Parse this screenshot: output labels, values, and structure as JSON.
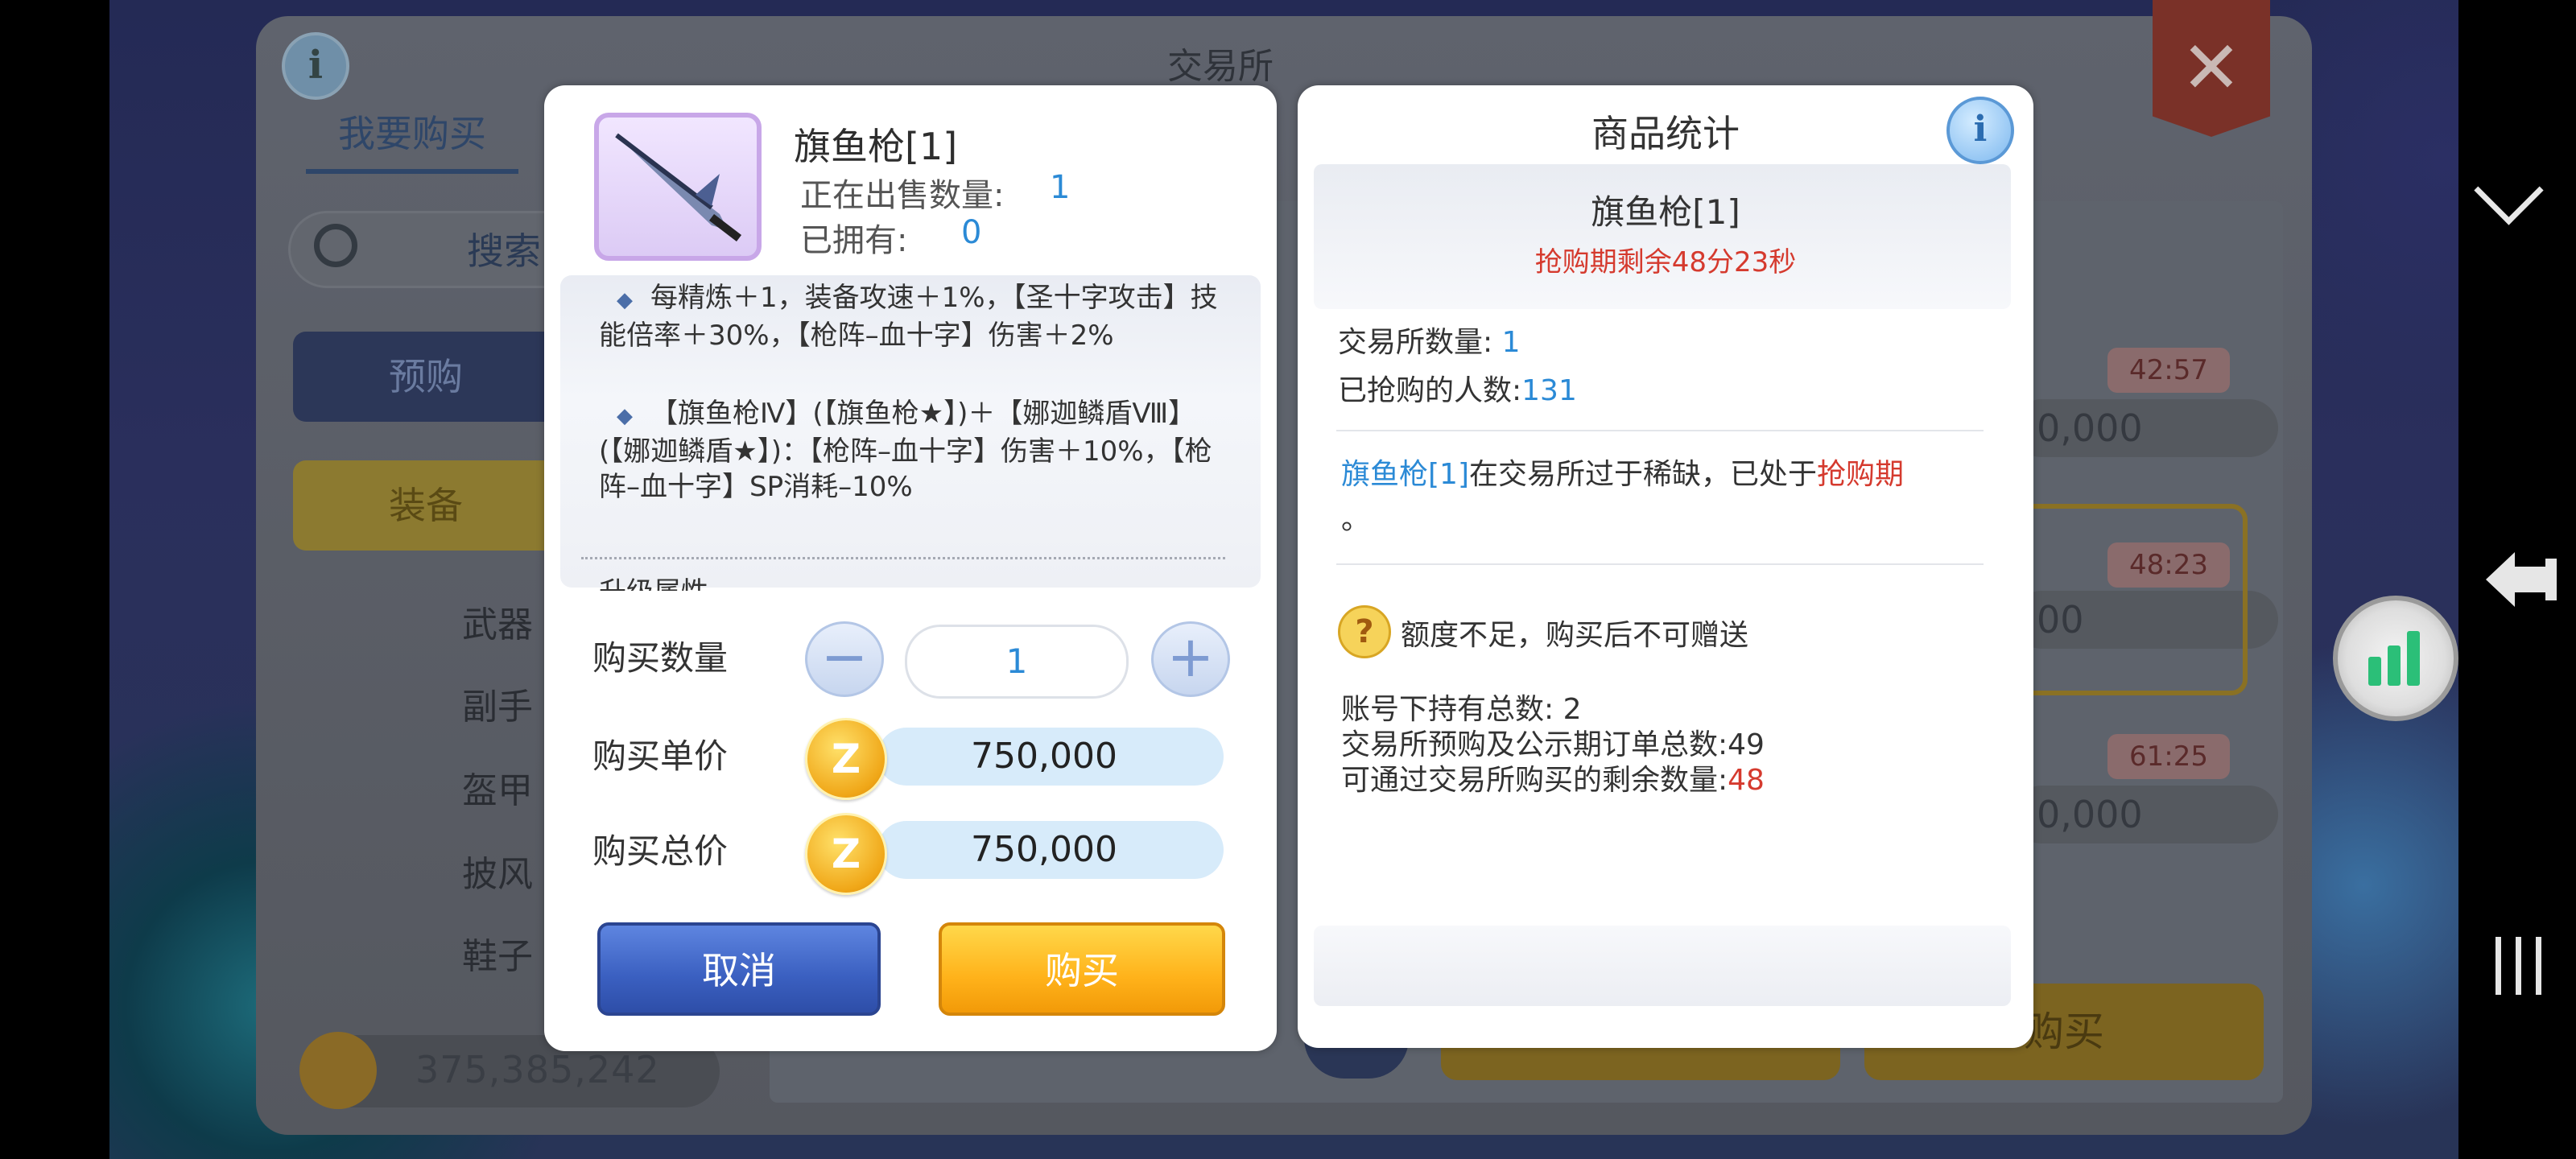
{
  "background": {
    "window_title": "交易所",
    "tab_buy": "我要购买",
    "search_placeholder": "搜索",
    "preorder": "预购",
    "equipment": "装备",
    "categories": [
      "武器",
      "副手",
      "盔甲",
      "披风",
      "鞋子"
    ],
    "currency_balance": "375,385,242",
    "timers": [
      "42:57",
      "48:23",
      "61:25"
    ],
    "prices": [
      "0,000",
      "00",
      "0,000"
    ],
    "buy_label": "购买"
  },
  "item": {
    "name": "旗鱼枪[1]",
    "on_sale_label": "正在出售数量:",
    "on_sale_value": "1",
    "owned_label": "已拥有:",
    "owned_value": "0",
    "desc1": "每精炼＋1，装备攻速＋1%，【圣十字攻击】技能倍率＋30%，【枪阵–血十字】伤害＋2%",
    "desc2": "【旗鱼枪Ⅳ】(【旗鱼枪★】)＋【娜迦鳞盾Ⅷ】(【娜迦鳞盾★】)：【枪阵–血十字】伤害＋10%，【枪阵–血十字】SP消耗–10%",
    "desc3": "升级属性"
  },
  "purchase": {
    "qty_label": "购买数量",
    "qty_value": "1",
    "unit_price_label": "购买单价",
    "unit_price": "750,000",
    "total_price_label": "购买总价",
    "total_price": "750,000",
    "cancel": "取消",
    "buy": "购买"
  },
  "stats": {
    "title": "商品统计",
    "item_name": "旗鱼枪[1]",
    "rush_timer": "抢购期剩余48分23秒",
    "exchange_qty_label": "交易所数量:",
    "exchange_qty": "1",
    "buyers_label": "已抢购的人数:",
    "buyers": "131",
    "scarce_item": "旗鱼枪[1]",
    "scarce_text": "在交易所过于稀缺，已处于",
    "scarce_period": "抢购期",
    "scarce_end": "。",
    "warning": "额度不足，购买后不可赠送",
    "account_total_label": "账号下持有总数:",
    "account_total": "2",
    "orders_label": "交易所预购及公示期订单总数:",
    "orders": "49",
    "remain_label": "可通过交易所购买的剩余数量:",
    "remain": "48"
  },
  "icons": {
    "info": "i",
    "zeny": "Z",
    "minus": "−",
    "plus": "+",
    "warning": "?",
    "close": "✕"
  },
  "colors": {
    "accent_blue": "#2b8ad6",
    "alert_red": "#d53a2e",
    "buy_yellow": "#ffb21a",
    "cancel_blue": "#3a5fc0"
  }
}
